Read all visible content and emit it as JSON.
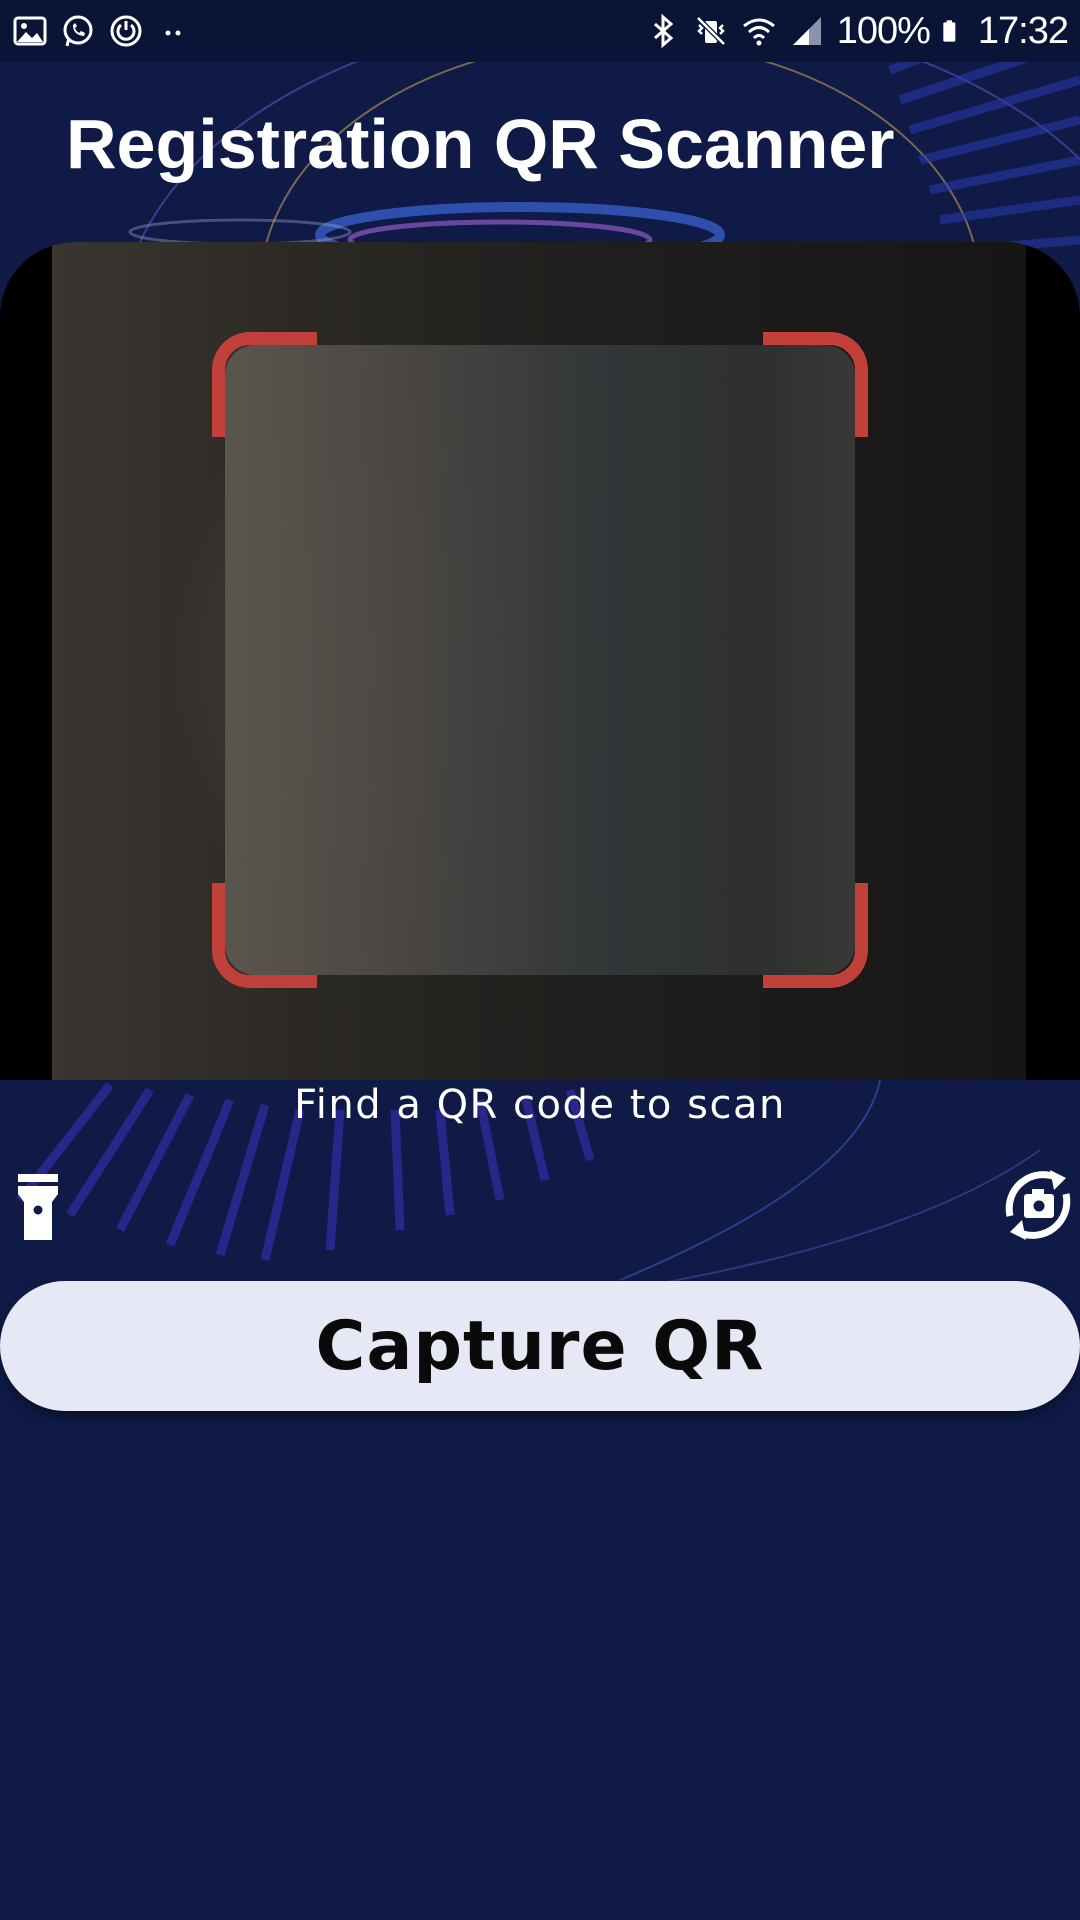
{
  "status_bar": {
    "left_icons": [
      "gallery-icon",
      "whatsapp-icon",
      "power-sync-icon",
      "more-notifications-icon"
    ],
    "right_icons": [
      "bluetooth-icon",
      "vibrate-mute-icon",
      "wifi-icon",
      "cellular-signal-icon",
      "battery-icon"
    ],
    "battery": "100%",
    "time": "17:32"
  },
  "header": {
    "title": "Registration QR Scanner"
  },
  "scanner": {
    "frame_color": "#c2403a",
    "hint": "Find a QR code to scan",
    "flashlight_icon": "flashlight-icon",
    "switch_camera_icon": "switch-camera-icon"
  },
  "actions": {
    "capture_label": "Capture QR"
  },
  "colors": {
    "background": "#0f1a47",
    "status_bar": "#0a1436",
    "button": "#e6e9f5"
  }
}
